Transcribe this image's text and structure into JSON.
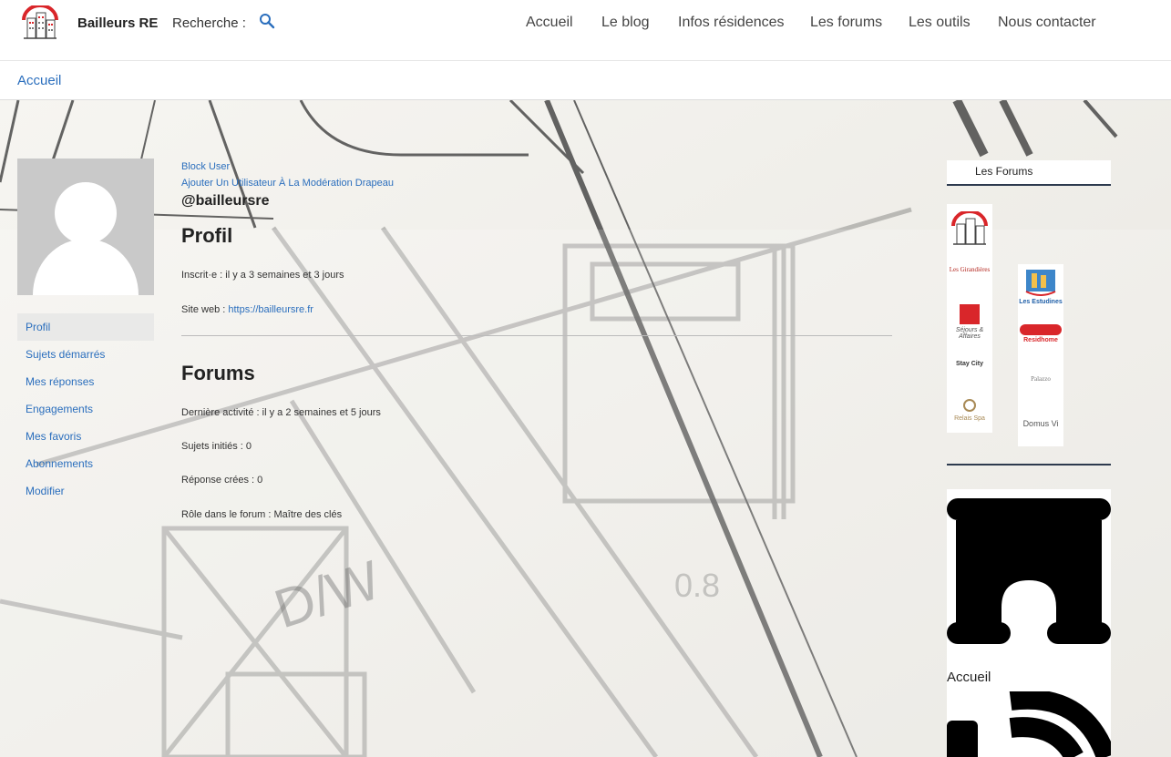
{
  "header": {
    "site_name": "Bailleurs RE",
    "search_label": "Recherche :",
    "nav": [
      "Accueil",
      "Le blog",
      "Infos résidences",
      "Les forums",
      "Les outils",
      "Nous contacter"
    ]
  },
  "breadcrumb": "Accueil",
  "profile": {
    "block_user": "Block User",
    "add_moderation": "Ajouter Un Utilisateur À La Modération Drapeau",
    "handle": "@bailleursre",
    "menu": [
      "Profil",
      "Sujets démarrés",
      "Mes réponses",
      "Engagements",
      "Mes favoris",
      "Abonnements",
      "Modifier"
    ],
    "active_menu": "Profil",
    "profil_title": "Profil",
    "registered": "Inscrit·e : il y a 3 semaines et 3 jours",
    "website_label": "Site web :",
    "website_url": "https://bailleursre.fr",
    "forums_title": "Forums",
    "last_activity": "Dernière activité : il y a 2 semaines et 5 jours",
    "topics_started": "Sujets initiés : 0",
    "replies": "Réponse crées : 0",
    "forum_role": "Rôle dans le forum : Maître des clés"
  },
  "sidebar": {
    "forums_title": "Les Forums",
    "brands_left": [
      "Les Girandières",
      "Séjours & Affaires",
      "Stay City",
      "Relais Spa"
    ],
    "brands_right": [
      "Les Estudines",
      "Residhome",
      "Palazzo",
      "Domus Vi"
    ],
    "home_label": "Accueil"
  },
  "colors": {
    "link": "#2a6ebd",
    "accent": "#2d3a4e"
  }
}
